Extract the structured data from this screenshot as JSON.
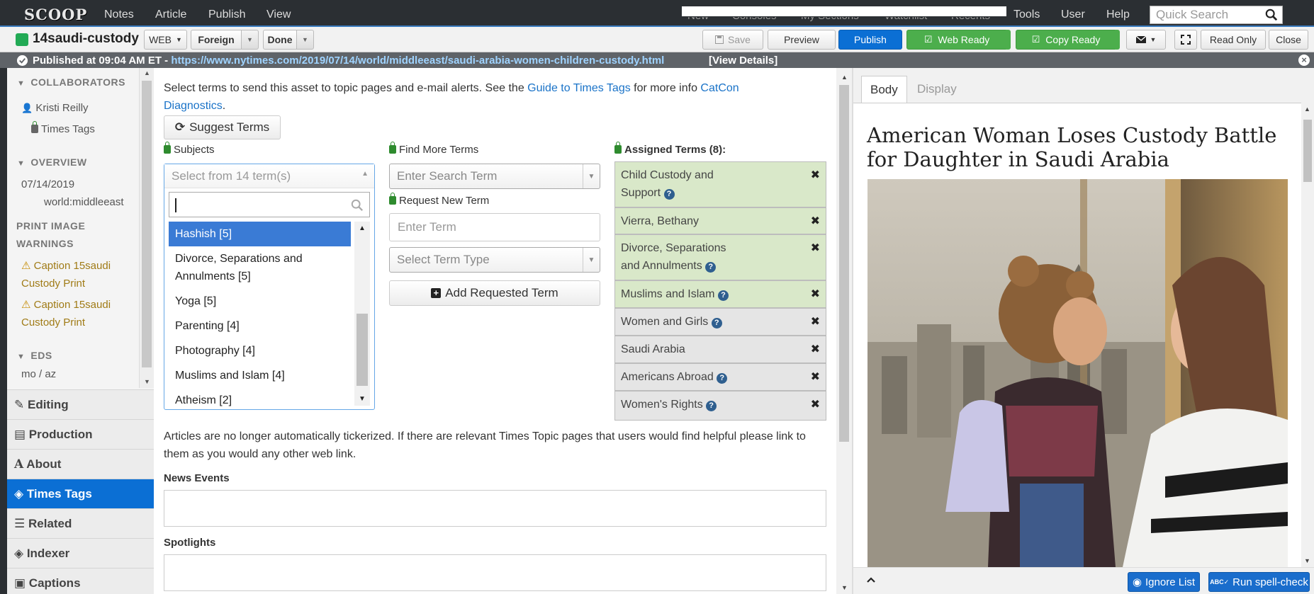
{
  "topbar": {
    "logo": "SCOOP",
    "menu": [
      "Notes",
      "Article",
      "Publish",
      "View"
    ],
    "menu_right": [
      "New",
      "Consoles",
      "My Sections",
      "Watchlist",
      "Recents",
      "Tools",
      "User",
      "Help"
    ],
    "search_placeholder": "Quick Search"
  },
  "toolbar": {
    "slug": "14saudi-custody",
    "web_label": "WEB",
    "foreign_label": "Foreign",
    "done_label": "Done",
    "save_label": "Save",
    "preview_label": "Preview",
    "publish_label": "Publish",
    "web_ready_label": "Web Ready",
    "copy_ready_label": "Copy Ready",
    "read_only_label": "Read Only",
    "close_label": "Close"
  },
  "banner": {
    "text": "Published at 09:04 AM ET - ",
    "url": "https://www.nytimes.com/2019/07/14/world/middleeast/saudi-arabia-women-children-custody.html",
    "details": "[View Details]"
  },
  "sidebar": {
    "collaborators_header": "COLLABORATORS",
    "collaborator": "Kristi Reilly",
    "times_tags": "Times Tags",
    "overview_header": "OVERVIEW",
    "date": "07/14/2019",
    "section": "world:middleeast",
    "print_warnings_header_1": "PRINT IMAGE",
    "print_warnings_header_2": "WARNINGS",
    "warnings": [
      {
        "line1": "Caption 15saudi",
        "line2": "Custody Print"
      },
      {
        "line1": "Caption 15saudi",
        "line2": "Custody Print"
      }
    ],
    "eds_header": "EDS",
    "eds_value": "mo / az",
    "nav": [
      {
        "label": "Editing",
        "icon": "pencil-icon"
      },
      {
        "label": "Production",
        "icon": "book-icon"
      },
      {
        "label": "About",
        "icon": "font-icon"
      },
      {
        "label": "Times Tags",
        "icon": "tags-icon"
      },
      {
        "label": "Related",
        "icon": "list-icon"
      },
      {
        "label": "Indexer",
        "icon": "tags-icon"
      },
      {
        "label": "Captions",
        "icon": "image-icon"
      }
    ]
  },
  "main": {
    "intro_text": "Select terms to send this asset to topic pages and e-mail alerts. See the ",
    "guide_link": "Guide to Times Tags",
    "intro_mid": " for more info ",
    "catcon_link": "CatCon Diagnostics",
    "intro_end": ".",
    "suggest_label": "Suggest Terms",
    "subjects_label": "Subjects",
    "subjects_placeholder": "Select from 14 term(s)",
    "dropdown_items": [
      "Hashish [5]",
      "Divorce, Separations and Annulments [5]",
      "Yoga [5]",
      "Parenting [4]",
      "Photography [4]",
      "Muslims and Islam [4]",
      "Atheism [2]"
    ],
    "find_label": "Find More Terms",
    "search_placeholder": "Enter Search Term",
    "request_label": "Request New Term",
    "term_placeholder": "Enter Term",
    "term_type_placeholder": "Select Term Type",
    "add_label": "Add Requested Term",
    "assigned_label": "Assigned Terms (8):",
    "assigned_terms": [
      {
        "line1": "Child Custody and",
        "line2": "Support",
        "help": true
      },
      {
        "line1": "Vierra, Bethany",
        "line2": "",
        "help": false
      },
      {
        "line1": "Divorce, Separations",
        "line2": "and Annulments",
        "help": true
      },
      {
        "line1": "Muslims and Islam",
        "line2": "",
        "help": true
      },
      {
        "line1": "Women and Girls",
        "line2": "",
        "help": true
      },
      {
        "line1": "Saudi Arabia",
        "line2": "",
        "help": false
      },
      {
        "line1": "Americans Abroad",
        "line2": "",
        "help": true
      },
      {
        "line1": "Women's Rights",
        "line2": "",
        "help": true
      }
    ],
    "ticker_note": "Articles are no longer automatically tickerized. If there are relevant Times Topic pages that users would find helpful please link to them as you would any other web link.",
    "news_events_label": "News Events",
    "spotlights_label": "Spotlights"
  },
  "preview": {
    "tab_body": "Body",
    "tab_display": "Display",
    "headline": "American Woman Loses Custody Battle for Daughter in Saudi Arabia",
    "ignore_list_label": "Ignore List",
    "spellcheck_label": "Run spell-check"
  },
  "colors": {
    "primary": "#0b6fd4",
    "green": "#4cae4c",
    "assigned_green": "#d9e8c9",
    "topbar": "#2b2f33"
  }
}
